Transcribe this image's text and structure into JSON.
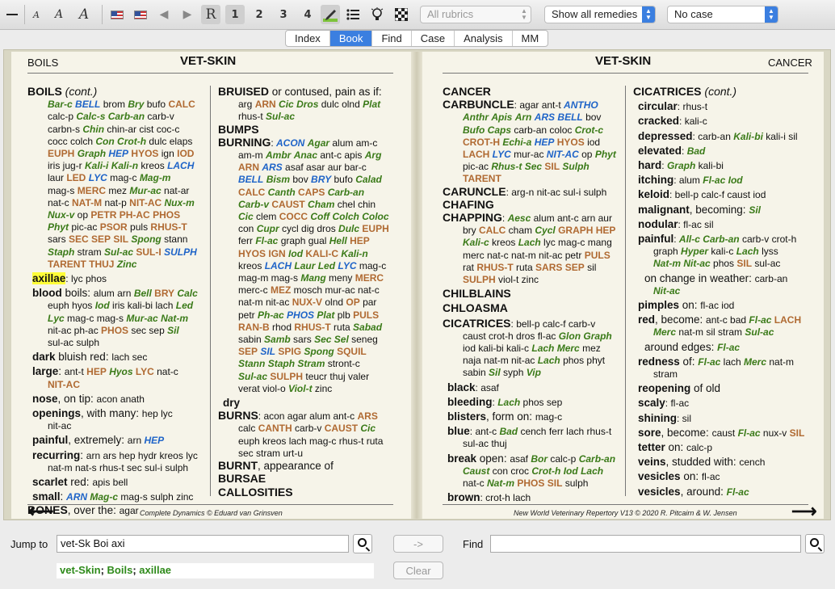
{
  "toolbar": {
    "icons": [
      "minus-icon",
      "small-a-icon",
      "medium-a-icon",
      "large-a-icon",
      "us-flag-icon",
      "us-flag-icon",
      "back-triangle-icon",
      "forward-triangle-icon",
      "r-icon",
      "one-icon",
      "two-icon",
      "three-icon",
      "four-icon",
      "pen-icon",
      "list-icon",
      "bulb-icon",
      "grid-icon"
    ],
    "font_small": "A",
    "font_medium": "A",
    "font_large": "A",
    "r_label": "R",
    "n1": "1",
    "n2": "2",
    "n3": "3",
    "n4": "4",
    "rubrics": "All rubrics",
    "remedies": "Show all remedies",
    "case": "No case"
  },
  "tabs": [
    "Index",
    "Book",
    "Find",
    "Case",
    "Analysis",
    "MM"
  ],
  "active_tab": "Book",
  "left_page": {
    "runhead": "BOILS",
    "title": "VET-SKIN",
    "footer": "Complete Dynamics © Eduard van Grinsven"
  },
  "right_page": {
    "runhead": "CANCER",
    "title": "VET-SKIN",
    "footer": "New World Veterinary Repertory V13 © 2020 R. Pitcairn & W. Jensen"
  },
  "col1": {
    "boils": "BOILS",
    "cont": "(cont.)",
    "l1a": "Bar-c",
    "l1b": "BELL",
    "l1c": " brom ",
    "l1d": "Bry",
    "l1e": " bufo ",
    "l1f": "CALC",
    "l2a": "calc-p ",
    "l2b": "Calc-s",
    "l2c": " ",
    "l2d": "Carb-an",
    "l2e": " carb-v",
    "l3": "carbn-s ",
    "l3b": "Chin",
    "l3c": " chin-ar  cist  coc-c",
    "l4": "cocc  colch ",
    "l4b": "Con",
    "l4c": " ",
    "l4d": "Crot-h",
    "l4e": " dulc  elaps",
    "l5a": "EUPH",
    "l5b": " ",
    "l5c": "Graph",
    "l5d": " ",
    "l5e": "HEP",
    "l5f": " ",
    "l5g": "HYOS",
    "l5h": "  ign  ",
    "l5i": "IOD",
    "l6": "iris  jug-r ",
    "l6b": "Kali-i",
    "l6c": " ",
    "l6d": "Kali-n",
    "l6e": "  kreos  ",
    "l6f": "LACH",
    "l7": "laur  ",
    "l7b": "LED",
    "l7c": "  ",
    "l7d": "LYC",
    "l7e": "  mag-c  ",
    "l7f": "Mag-m",
    "l8": "mag-s  ",
    "l8b": "MERC",
    "l8c": "  mez  ",
    "l8d": "Mur-ac",
    "l8e": "  nat-ar",
    "l9": "nat-c  ",
    "l9b": "NAT-M",
    "l9c": "  nat-p  ",
    "l9d": "NIT-AC",
    "l9e": "  ",
    "l9f": "Nux-m",
    "l10a": "Nux-v",
    "l10b": "  op  ",
    "l10c": "PETR",
    "l10d": "  ",
    "l10e": "PH-AC",
    "l10f": "  ",
    "l10g": "PHOS",
    "l11a": "Phyt",
    "l11b": "  pic-ac  ",
    "l11c": "PSOR",
    "l11d": "  puls  ",
    "l11e": "RHUS-T",
    "l12": "sars  ",
    "l12b": "SEC",
    "l12c": "  ",
    "l12d": "SEP",
    "l12e": "  ",
    "l12f": "SIL",
    "l12g": "  ",
    "l12h": "Spong",
    "l12i": "  stann",
    "l13a": "Staph",
    "l13b": "  stram  ",
    "l13c": "Sul-ac",
    "l13d": "  ",
    "l13e": "SUL-I",
    "l13f": "  ",
    "l13g": "SULPH",
    "l14a": "TARENT",
    "l14b": "  ",
    "l14c": "THUJ",
    "l14d": "  ",
    "l14e": "Zinc",
    "axillae": "axillae",
    "axillae_r": ": lyc  phos",
    "blood": "blood",
    "blood_t": " boils: ",
    "blood_r": "alum  arn  ",
    "blood_b": "Bell",
    "blood_c": "  ",
    "blood_d": "BRY",
    "blood_e": "  ",
    "blood_f": "Calc",
    "b2": "euph  hyos  ",
    "b2b": "Iod",
    "b2c": "  iris  kali-bi  lach  ",
    "b2d": "Led",
    "b3a": "Lyc",
    "b3b": "  mag-c  mag-s  ",
    "b3c": "Mur-ac",
    "b3d": "  ",
    "b3e": "Nat-m",
    "b4": "nit-ac  ph-ac  ",
    "b4b": "PHOS",
    "b4c": "  sec  sep  ",
    "b4d": "Sil",
    "b5": "sul-ac  sulph",
    "dark": "dark",
    "dark_t": " bluish red: ",
    "dark_r": "lach  sec",
    "large": "large",
    "large_t": ":  ",
    "large_r": "ant-t  ",
    "large_b": "HEP",
    "large_c": "  ",
    "large_d": "Hyos",
    "large_e": "  ",
    "large_f": "LYC",
    "large_g": "  nat-c",
    "large2": "NIT-AC",
    "nose": "nose",
    "nose_t": ", on tip: ",
    "nose_r": "acon  anath",
    "open": "openings",
    "open_t": ", with many: ",
    "open_r": "hep  lyc",
    "open2": "nit-ac",
    "painful": "painful",
    "painful_t": ", extremely: ",
    "painful_r": "arn  ",
    "painful_b": "HEP",
    "recur": "recurring",
    "recur_t": ": ",
    "recur_r": "arn  ars  hep  hydr  kreos  lyc",
    "recur2": "nat-m  nat-s  rhus-t  sec  sul-i  sulph",
    "scarlet": "scarlet",
    "scarlet_t": " red: ",
    "scarlet_r": "apis  bell",
    "small": "small",
    "small_t": ":  ",
    "small_b": "ARN",
    "small_c": "  ",
    "small_d": "Mag-c",
    "small_e": "  mag-s  sulph  zinc",
    "bones": "BONES",
    "bones_t": ", over the: ",
    "bones_r": "agar"
  },
  "col2": {
    "bruised": "BRUISED",
    "bruised_t": " or contused, pain as if:",
    "br2": "arg  ",
    "br2b": "ARN",
    "br2c": "  ",
    "br2d": "Cic",
    "br2e": "  ",
    "br2f": "Dros",
    "br2g": "  dulc  olnd  ",
    "br2h": "Plat",
    "br3": "rhus-t  ",
    "br3b": "Sul-ac",
    "bumps": "BUMPS",
    "burning": "BURNING",
    "burn_t": ":  ",
    "bn1a": "ACON",
    "bn1b": "  ",
    "bn1c": "Agar",
    "bn1d": "  alum  am-c",
    "bn2": "am-m  ",
    "bn2b": "Ambr",
    "bn2c": "  ",
    "bn2d": "Anac",
    "bn2e": "  ant-c  apis  ",
    "bn2f": "Arg",
    "bn3a": "ARN",
    "bn3b": "  ",
    "bn3c": "ARS",
    "bn3d": "  asaf  asar  aur  bar-c",
    "bn4a": "BELL",
    "bn4b": "  ",
    "bn4c": "Bism",
    "bn4d": "  bov  ",
    "bn4e": "BRY",
    "bn4f": "  bufo  ",
    "bn4g": "Calad",
    "bn5a": "CALC",
    "bn5b": "  ",
    "bn5c": "Canth",
    "bn5d": "  ",
    "bn5e": "CAPS",
    "bn5f": "  ",
    "bn5g": "Carb-an",
    "bn6a": "Carb-v",
    "bn6b": "  ",
    "bn6c": "CAUST",
    "bn6d": "  ",
    "bn6e": "Cham",
    "bn6f": "  chel  chin",
    "bn7a": "Cic",
    "bn7b": "  clem  ",
    "bn7c": "COCC",
    "bn7d": "  ",
    "bn7e": "Coff",
    "bn7f": "  ",
    "bn7g": "Colch",
    "bn7h": "  ",
    "bn7i": "Coloc",
    "bn8": "con  ",
    "bn8b": "Cupr",
    "bn8c": "  cycl  dig  dros  ",
    "bn8d": "Dulc",
    "bn8e": "  ",
    "bn8f": "EUPH",
    "bn9": "ferr  ",
    "bn9b": "Fl-ac",
    "bn9c": "  graph  gual  ",
    "bn9d": "Hell",
    "bn9e": "  ",
    "bn9f": "HEP",
    "bn10a": "HYOS",
    "bn10b": "  ",
    "bn10c": "IGN",
    "bn10d": "  ",
    "bn10e": "Iod",
    "bn10f": "  ",
    "bn10g": "KALI-C",
    "bn10h": "  ",
    "bn10i": "Kali-n",
    "bn11": "kreos  ",
    "bn11b": "LACH",
    "bn11c": "  ",
    "bn11d": "Laur",
    "bn11e": "  ",
    "bn11f": "Led",
    "bn11g": "  ",
    "bn11h": "LYC",
    "bn11i": "  mag-c",
    "bn12": "mag-m  mag-s  ",
    "bn12b": "Mang",
    "bn12c": "  meny  ",
    "bn12d": "MERC",
    "bn13": "merc-c  ",
    "bn13b": "MEZ",
    "bn13c": "  mosch  mur-ac  nat-c",
    "bn14": "nat-m  nit-ac  ",
    "bn14b": "NUX-V",
    "bn14c": "  olnd  ",
    "bn14d": "OP",
    "bn14e": "  par",
    "bn15": "petr  ",
    "bn15b": "Ph-ac",
    "bn15c": "  ",
    "bn15d": "PHOS",
    "bn15e": "  ",
    "bn15f": "Plat",
    "bn15g": "  plb  ",
    "bn15h": "PULS",
    "bn16a": "RAN-B",
    "bn16b": "  rhod  ",
    "bn16c": "RHUS-T",
    "bn16d": "  ruta  ",
    "bn16e": "Sabad",
    "bn17": "sabin  ",
    "bn17b": "Samb",
    "bn17c": "  sars  ",
    "bn17d": "Sec",
    "bn17e": "  ",
    "bn17f": "Sel",
    "bn17g": "  seneg",
    "bn18a": "SEP",
    "bn18b": "  ",
    "bn18c": "SIL",
    "bn18d": "  ",
    "bn18e": "SPIG",
    "bn18f": "  ",
    "bn18g": "Spong",
    "bn18h": "  ",
    "bn18i": "SQUIL",
    "bn19a": "Stann",
    "bn19b": " ",
    "bn19c": "Staph",
    "bn19d": " ",
    "bn19e": "Stram",
    "bn19f": "  stront-c",
    "bn20a": "Sul-ac",
    "bn20b": "  ",
    "bn20c": "SULPH",
    "bn20d": "  teucr  thuj  valer",
    "bn21": "verat  viol-o  ",
    "bn21b": "Viol-t",
    "bn21c": "  zinc",
    "dry": "dry",
    "burns": "BURNS",
    "burns_t": ":  ",
    "bs1": "acon  agar  alum  ant-c  ",
    "bs1b": "ARS",
    "bs2": "calc  ",
    "bs2b": "CANTH",
    "bs2c": "  carb-v  ",
    "bs2d": "CAUST",
    "bs2e": "  ",
    "bs2f": "Cic",
    "bs3": "euph  kreos  lach  mag-c  rhus-t  ruta",
    "bs4": "sec  stram  urt-u",
    "burnt": "BURNT",
    "burnt_t": ", appearance of",
    "bursae": "BURSAE",
    "callos": "CALLOSITIES"
  },
  "col3": {
    "cancer": "CANCER",
    "carb": "CARBUNCLE",
    "carb_t": ":  ",
    "cb1": "agar  ant-t  ",
    "cb1b": "ANTHO",
    "cb2a": "Anthr",
    "cb2b": " ",
    "cb2c": "Apis",
    "cb2d": " ",
    "cb2e": "Arn",
    "cb2f": "  ",
    "cb2g": "ARS",
    "cb2h": " ",
    "cb2i": "BELL",
    "cb2j": "  bov",
    "cb3a": "Bufo",
    "cb3b": " ",
    "cb3c": "Caps",
    "cb3d": "  carb-an  coloc  ",
    "cb3e": "Crot-c",
    "cb4a": "CROT-H",
    "cb4b": "  ",
    "cb4c": "Echi-a",
    "cb4d": "  ",
    "cb4e": "HEP",
    "cb4f": "  ",
    "cb4g": "HYOS",
    "cb4h": "  iod",
    "cb5a": "LACH",
    "cb5b": "  ",
    "cb5c": "LYC",
    "cb5d": "  mur-ac  ",
    "cb5e": "NIT-AC",
    "cb5f": "  op  ",
    "cb5g": "Phyt",
    "cb6": "pic-ac  ",
    "cb6b": "Rhus-t",
    "cb6c": "  ",
    "cb6d": "Sec",
    "cb6e": "  ",
    "cb6f": "SIL",
    "cb6g": "  ",
    "cb6h": "Sulph",
    "cb7": "TARENT",
    "caruncle": "CARUNCLE",
    "car_t": ":  ",
    "car_r": "arg-n  nit-ac  sul-i  sulph",
    "chafing": "CHAFING",
    "chapping": "CHAPPING",
    "ch_t": ":  ",
    "ch1": "Aesc",
    "ch1b": "  alum  ant-c  arn  aur",
    "ch2": "bry  ",
    "ch2b": "CALC",
    "ch2c": "  cham  ",
    "ch2d": "Cycl",
    "ch2e": "  ",
    "ch2f": "GRAPH",
    "ch2g": "  ",
    "ch2h": "HEP",
    "ch3a": "Kali-c",
    "ch3b": "  kreos  ",
    "ch3c": "Lach",
    "ch3d": "  lyc  mag-c  mang",
    "ch4": "merc  nat-c  nat-m  nit-ac  petr  ",
    "ch4b": "PULS",
    "ch5": "rat  ",
    "ch5b": "RHUS-T",
    "ch5c": "  ruta  ",
    "ch5d": "SARS",
    "ch5e": "  ",
    "ch5f": "SEP",
    "ch5g": "  sil",
    "ch6a": "SULPH",
    "ch6b": "  viol-t  zinc",
    "chilb": "CHILBLAINS",
    "chloasma": "CHLOASMA",
    "cicatrices": "CICATRICES",
    "ci_t": ":  ",
    "ci1": "bell-p  calc-f  carb-v",
    "ci2": "caust  crot-h  dros  fl-ac  ",
    "ci2b": "Glon",
    "ci2c": " ",
    "ci2d": "Graph",
    "ci3": "iod  kali-bi  kali-c  ",
    "ci3b": "Lach",
    "ci3c": "  ",
    "ci3d": "Merc",
    "ci3e": "  mez",
    "ci4": "naja  nat-m  nit-ac  ",
    "ci4b": "Lach",
    "ci4c": "  phos  phyt",
    "ci5": "sabin  ",
    "ci5b": "Sil",
    "ci5c": "  syph  ",
    "ci5d": "Vip",
    "black": "black",
    "black_r": ": asaf",
    "bleed": "bleeding",
    "bleed_t": ":  ",
    "bleed_b": "Lach",
    "bleed_c": "  phos  sep",
    "blisters": "blisters",
    "blisters_t": ", form on: ",
    "blisters_r": "mag-c",
    "blue": "blue",
    "blue_t": ":  ",
    "blue_r": "ant-c  ",
    "blue_b": "Bad",
    "blue_c": "  cench  ferr  lach  rhus-t",
    "blue2": "sul-ac  thuj",
    "break": "break",
    "break_t": " open:  ",
    "break_r": "asaf  ",
    "break_b": "Bor",
    "break_c": "  calc-p  ",
    "break_d": "Carb-an",
    "bk2a": "Caust",
    "bk2b": "  con  croc  ",
    "bk2c": "Crot-h",
    "bk2d": "  ",
    "bk2e": "Iod",
    "bk2f": "  ",
    "bk2g": "Lach",
    "bk3": "nat-c  ",
    "bk3b": "Nat-m",
    "bk3c": "  ",
    "bk3d": "PHOS",
    "bk3e": "  ",
    "bk3f": "SIL",
    "bk3g": "  sulph",
    "brown": "brown",
    "brown_t": ": ",
    "brown_r": "crot-h  lach"
  },
  "col4": {
    "cicatrices": "CICATRICES",
    "cont": "(cont.)",
    "circular": "circular",
    "circular_r": ": rhus-t",
    "cracked": "cracked",
    "cracked_r": ": kali-c",
    "depressed": "depressed",
    "dep_r": ": carb-an  ",
    "dep_b": "Kali-bi",
    "dep_c": "  kali-i  sil",
    "elevated": "elevated",
    "elev_t": ":  ",
    "elev_b": "Bad",
    "hard": "hard",
    "hard_t": ":  ",
    "hard_b": "Graph",
    "hard_c": "  kali-bi",
    "itching": "itching",
    "itch_r": ": alum  ",
    "itch_b": "Fl-ac",
    "itch_c": " ",
    "itch_d": "Iod",
    "keloid": "keloid",
    "kel_r": ": bell-p  calc-f  caust  iod",
    "malignant": "malignant",
    "mal_t": ", becoming:  ",
    "mal_b": "Sil",
    "nodular": "nodular",
    "nod_r": ": fl-ac  sil",
    "painful": "painful",
    "pf_t": ":  ",
    "pf_b": "All-c",
    "pf_c": "  ",
    "pf_d": "Carb-an",
    "pf_e": "  carb-v  crot-h",
    "pf2": "graph  ",
    "pf2b": "Hyper",
    "pf2c": "  kali-c  ",
    "pf2d": "Lach",
    "pf2e": "  lyss",
    "pf3a": "Nat-m",
    "pf3b": "  ",
    "pf3c": "Nit-ac",
    "pf3d": "  phos  ",
    "pf3e": "SIL",
    "pf3f": "  sul-ac",
    "weather": "on change in weather: ",
    "weather_r": "carb-an",
    "weather2": "Nit-ac",
    "pimples": "pimples",
    "pim_t": " on: ",
    "pim_r": "fl-ac  iod",
    "red": "red",
    "red_t": ", become: ",
    "red_r": "ant-c  bad  ",
    "red_b": "Fl-ac",
    "red_c": "  ",
    "red_d": "LACH",
    "red2a": "Merc",
    "red2b": "  nat-m  sil  stram  ",
    "red2c": "Sul-ac",
    "edges": "around edges: ",
    "edges_b": "Fl-ac",
    "redness": "redness",
    "rd_t": " of:  ",
    "rd_b": "Fl-ac",
    "rd_c": "  lach  ",
    "rd_d": "Merc",
    "rd_e": "  nat-m",
    "rd2": "stram",
    "reopening": "reopening",
    "reo_t": " of old",
    "scaly": "scaly",
    "scaly_r": ": fl-ac",
    "shining": "shining",
    "shin_r": ": sil",
    "sore": "sore",
    "sore_t": ", become: ",
    "sore_r": "caust  ",
    "sore_b": "Fl-ac",
    "sore_c": "  nux-v  ",
    "sore_d": "SIL",
    "tetter": "tetter",
    "tet_t": " on: ",
    "tet_r": "calc-p",
    "veins": "veins",
    "veins_t": ", studded with: ",
    "veins_r": "cench",
    "vesicles": "vesicles",
    "ves_t": " on: ",
    "ves_r": "fl-ac",
    "vesaround": "vesicles",
    "va_t": ", around:  ",
    "va_b": "Fl-ac"
  },
  "bottom": {
    "jump_label": "Jump to",
    "jump_value": "vet-Sk Boi axi",
    "go_button": "->",
    "find_label": "Find",
    "find_value": "",
    "clear_button": "Clear",
    "crumb1": "vet-Skin",
    "crumb_sep1": "; ",
    "crumb2": "Boils",
    "crumb_sep2": "; ",
    "crumb3": "axillae"
  },
  "colors": {
    "accent": "#3b7fe0",
    "remedy_green": "#3a7a18",
    "remedy_blue": "#1f64c8",
    "remedy_brown": "#b06a32",
    "highlight": "#fffd38"
  }
}
